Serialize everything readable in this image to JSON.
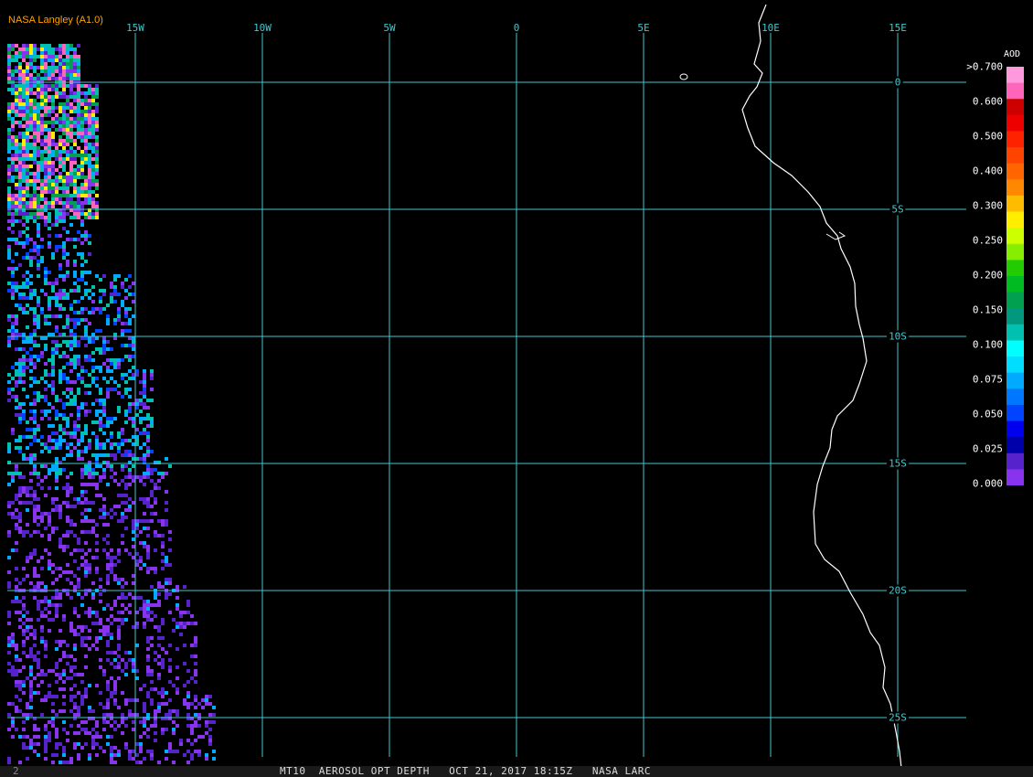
{
  "credit": "NASA Langley (A1.0)",
  "longitude_labels": [
    "15W",
    "10W",
    "5W",
    "0",
    "5E",
    "10E",
    "15E"
  ],
  "latitude_labels": [
    "0",
    "5S",
    "10S",
    "15S",
    "20S",
    "25S"
  ],
  "legend": {
    "title": "AOD",
    "labels": [
      ">0.700",
      "0.600",
      "0.500",
      "0.400",
      "0.300",
      "0.250",
      "0.200",
      "0.150",
      "0.100",
      "0.075",
      "0.050",
      "0.025",
      "0.000"
    ],
    "colors": [
      "#ff99dd",
      "#ff66bb",
      "#cc0000",
      "#ee0000",
      "#ff2200",
      "#ff4400",
      "#ff6600",
      "#ff8800",
      "#ffbb00",
      "#ffee00",
      "#ccff00",
      "#88ee00",
      "#22cc00",
      "#00bb22",
      "#00a050",
      "#009980",
      "#00c0b0",
      "#00ffff",
      "#00ddff",
      "#00aaff",
      "#0077ff",
      "#0044ff",
      "#0000ee",
      "#0000aa",
      "#5522cc",
      "#8833ee"
    ]
  },
  "footer": {
    "text": "MT10  AEROSOL OPT DEPTH   OCT 21, 2017 18:15Z   NASA LARC",
    "corner": "2"
  },
  "colors": {
    "grid": "#40c8d0",
    "coast": "#ffffff",
    "aod_low": "#8833ee",
    "aod_mid": "#00c0b0",
    "aod_high": "#ff66bb",
    "aod_peak": "#ffee00"
  }
}
